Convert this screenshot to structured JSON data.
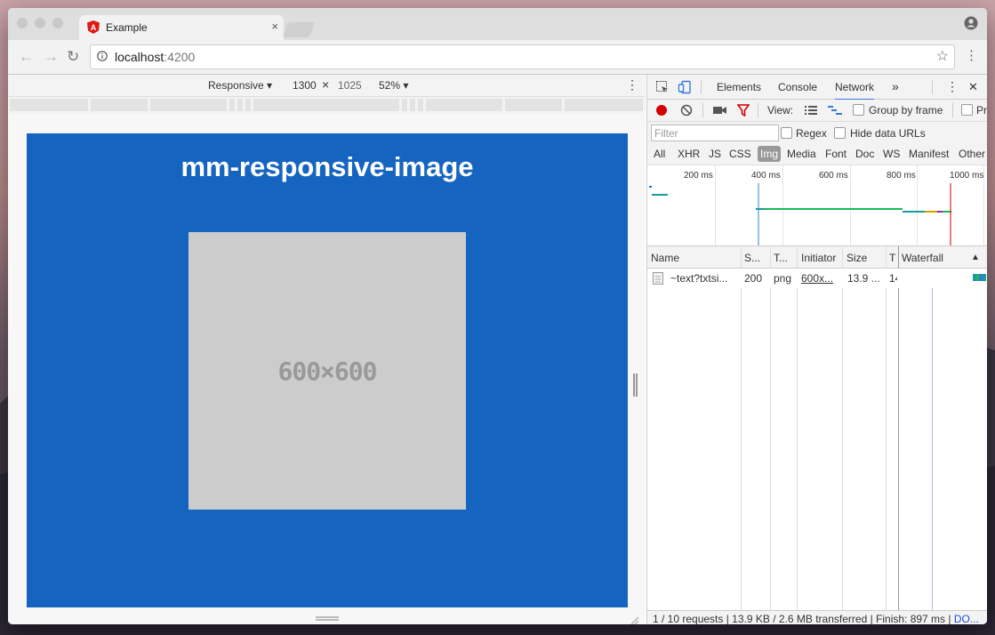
{
  "browser": {
    "tab_title": "Example",
    "tab_close": "×",
    "url_host": "localhost",
    "url_port": ":4200",
    "star": "☆",
    "menu": "⋮",
    "back": "←",
    "forward": "→",
    "reload": "↻"
  },
  "device_toolbar": {
    "device": "Responsive ▾",
    "width": "1300",
    "times": "×",
    "height": "1025",
    "zoom": "52% ▾",
    "more": "⋮"
  },
  "page": {
    "title": "mm-responsive-image",
    "placeholder_text": "600×600",
    "background": "#1565c0",
    "placeholder_color": "#cccccc"
  },
  "devtools": {
    "tabs": [
      "Elements",
      "Console",
      "Network"
    ],
    "more_tabs": "»",
    "menu": "⋮",
    "close": "✕",
    "toolbar": {
      "view_label": "View:",
      "group_by_frame": "Group by frame",
      "preserve": "Pr"
    },
    "filter": {
      "placeholder": "Filter",
      "regex": "Regex",
      "hide_data_urls": "Hide data URLs"
    },
    "types": [
      "All",
      "XHR",
      "JS",
      "CSS",
      "Img",
      "Media",
      "Font",
      "Doc",
      "WS",
      "Manifest",
      "Other"
    ],
    "active_type": "Img",
    "timeline_labels": [
      "200 ms",
      "400 ms",
      "600 ms",
      "800 ms",
      "1000 ms"
    ],
    "columns": [
      "Name",
      "S...",
      "T...",
      "Initiator",
      "Size",
      "T",
      "Waterfall",
      "▲"
    ],
    "rows": [
      {
        "name": "~text?txtsi...",
        "status": "200",
        "type": "png",
        "initiator": "600x...",
        "size": "13.9 ...",
        "time": "14"
      }
    ],
    "status_bar": "1 / 10 requests | 13.9 KB / 2.6 MB transferred | Finish: 897 ms | ",
    "status_link": "DO..."
  }
}
